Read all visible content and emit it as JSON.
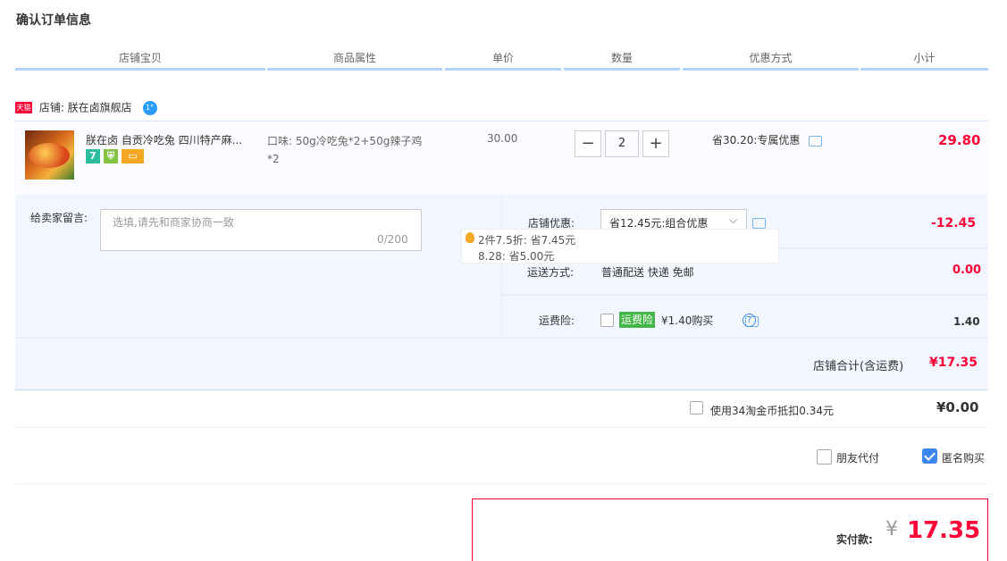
{
  "page_title": "确认订单信息",
  "table_headers": [
    "店铺宝贝",
    "商品属性",
    "单价",
    "数量",
    "优惠方式",
    "小计"
  ],
  "shop": {
    "badge": "天猫",
    "label": "店铺: 朕在卤旗舰店",
    "wangwang_icon": "1°"
  },
  "item": {
    "title": "朕在卤 自贡冷吃兔 四川特产麻...",
    "sku_line1": "口味: 50g冷吃兔*2+50g辣子鸡",
    "sku_line2": "*2",
    "unit_price": "30.00",
    "qty_minus": "−",
    "qty": "2",
    "qty_plus": "+",
    "promo": "省30.20:专属优惠",
    "subtotal": "29.80",
    "icons": [
      "seven-day-icon",
      "shield-icon",
      "card-icon"
    ],
    "icon_seven_text": "7"
  },
  "memo": {
    "label": "给卖家留言:",
    "placeholder": "选填,请先和商家协商一致",
    "count": "0/200"
  },
  "shop_promo": {
    "label": "店铺优惠:",
    "selected": "省12.45元:组合优惠",
    "value": "-12.45",
    "tip_line1": "2件7.5折: 省7.45元",
    "tip_line2": "8.28: 省5.00元"
  },
  "shipping": {
    "label": "运送方式:",
    "value": "普通配送 快递 免邮",
    "amount": "0.00"
  },
  "insurance": {
    "label": "运费险:",
    "tag": "运费险",
    "price": "¥1.40购买",
    "help": "?",
    "amount": "1.40"
  },
  "shop_total": {
    "label": "店铺合计(含运费)",
    "value": "¥17.35"
  },
  "coins": {
    "text": "使用34淘金币抵扣0.34元",
    "amount": "¥0.00"
  },
  "options": {
    "friend_pay": "朋友代付",
    "anonymous": "匿名购买"
  },
  "pay": {
    "label": "实付款:",
    "symbol": "¥",
    "value": "17.35"
  },
  "colors": {
    "accent_red": "#ff0036",
    "header_border": "#b2d1ff",
    "detail_bg": "#f2f7ff",
    "insurance_green": "#44b549",
    "check_blue": "#3d85f0"
  }
}
